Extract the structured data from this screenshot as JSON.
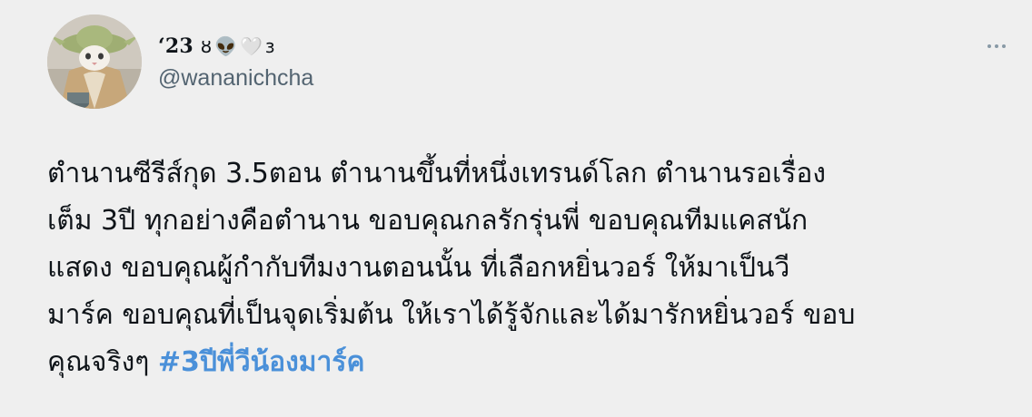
{
  "tweet": {
    "display_name": "‘23",
    "name_suffix_1": "ȣ",
    "name_emoji_alien": "👽",
    "name_emoji_heart": "🤍",
    "name_suffix_2": "ɜ",
    "handle": "@wananichcha",
    "more_icon": "more-dots-icon",
    "body_lines": [
      "ตำนานซีรีส์กุด 3.5ตอน ตำนานขึ้นที่หนึ่งเทรนด์โลก ตำนานรอเรื่อง",
      "เต็ม 3ปี ทุกอย่างคือตำนาน ขอบคุณกลรักรุ่นพี่ ขอบคุณทีมแคสนัก",
      "แสดง ขอบคุณผู้กำกับทีมงานตอนนั้น ที่เลือกหยิ่นวอร์ ให้มาเป็นวี",
      "มาร์ค ขอบคุณที่เป็นจุดเริ่มต้น ให้เราได้รู้จักและได้มารักหยิ่นวอร์ ขอบ"
    ],
    "last_line_text": "คุณจริงๆ ",
    "hashtag": "#3ปีพี่วีน้องมาร์ค",
    "hashtag_color": "#4a90d9",
    "background_color": "#efefef"
  }
}
